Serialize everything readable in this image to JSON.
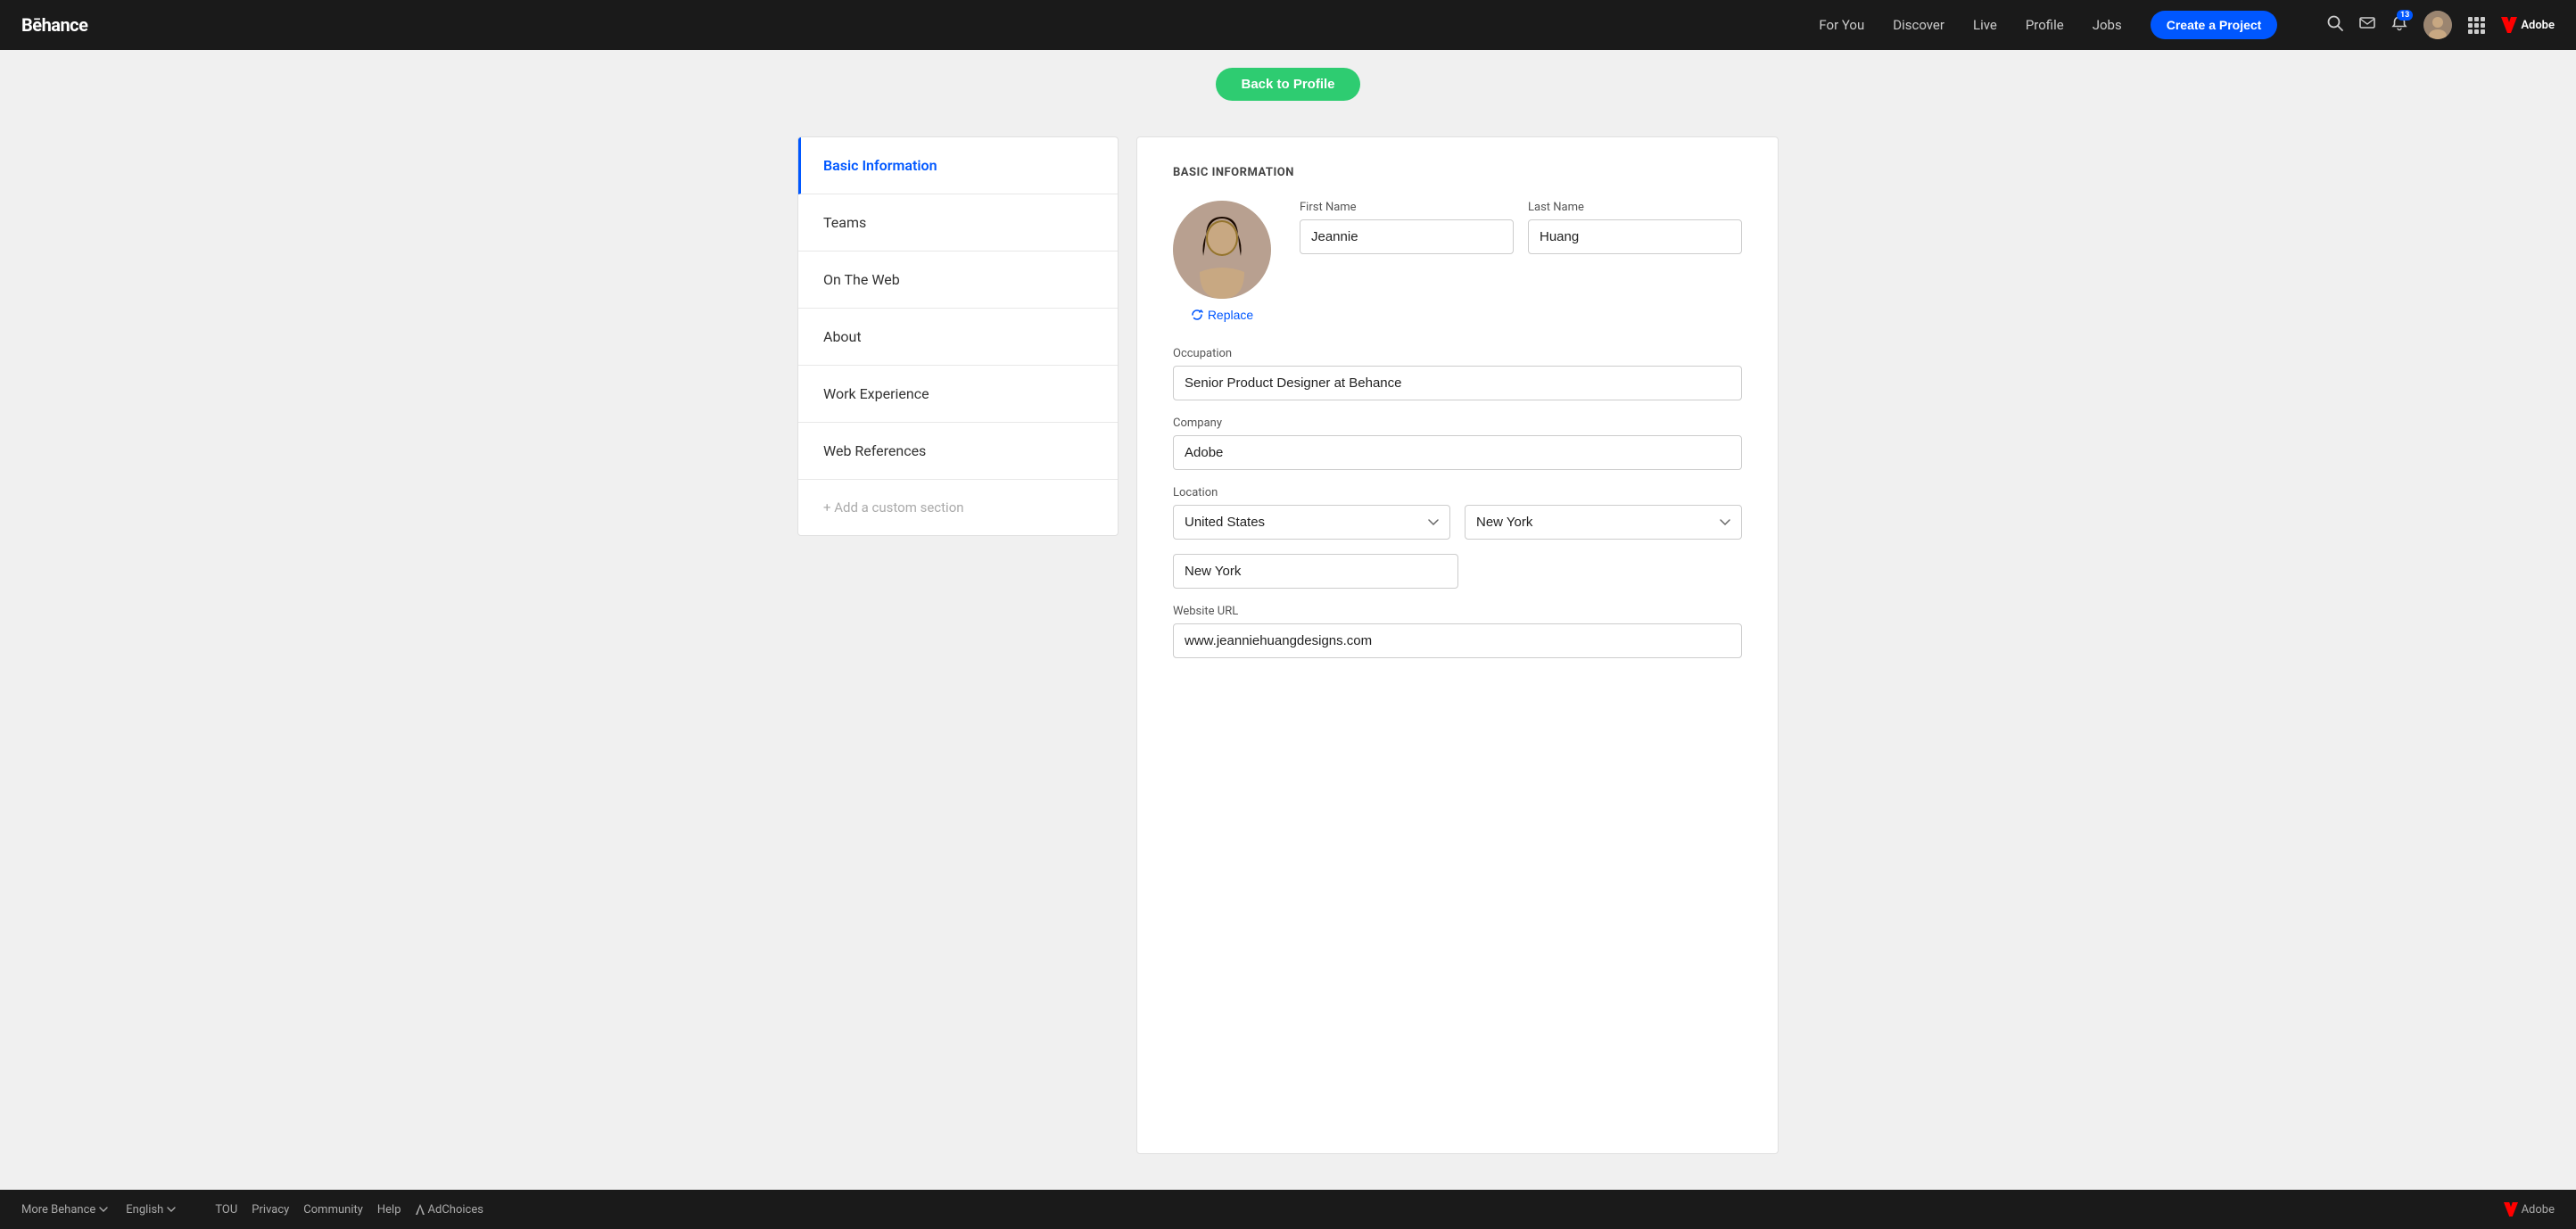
{
  "header": {
    "logo": "Bēhance",
    "nav": [
      {
        "label": "For You",
        "id": "for-you"
      },
      {
        "label": "Discover",
        "id": "discover"
      },
      {
        "label": "Live",
        "id": "live"
      },
      {
        "label": "Profile",
        "id": "profile"
      },
      {
        "label": "Jobs",
        "id": "jobs"
      }
    ],
    "create_project_label": "Create a Project",
    "notification_count": "13",
    "adobe_label": "Adobe"
  },
  "back_bar": {
    "button_label": "Back to Profile"
  },
  "sidebar": {
    "items": [
      {
        "label": "Basic Information",
        "id": "basic-information",
        "active": true
      },
      {
        "label": "Teams",
        "id": "teams",
        "active": false
      },
      {
        "label": "On The Web",
        "id": "on-the-web",
        "active": false
      },
      {
        "label": "About",
        "id": "about",
        "active": false
      },
      {
        "label": "Work Experience",
        "id": "work-experience",
        "active": false
      },
      {
        "label": "Web References",
        "id": "web-references",
        "active": false
      }
    ],
    "add_custom_label": "+ Add a custom section"
  },
  "form": {
    "section_title": "BASIC INFORMATION",
    "replace_label": "Replace",
    "fields": {
      "first_name_label": "First Name",
      "first_name_value": "Jeannie",
      "last_name_label": "Last Name",
      "last_name_value": "Huang",
      "occupation_label": "Occupation",
      "occupation_value": "Senior Product Designer at Behance",
      "company_label": "Company",
      "company_value": "Adobe",
      "location_label": "Location",
      "country_value": "United States",
      "state_value": "New York",
      "city_value": "New York",
      "website_label": "Website URL",
      "website_value": "www.jeanniehuangdesigns.com"
    }
  },
  "footer": {
    "more_behance_label": "More Behance",
    "language_label": "English",
    "tou_label": "TOU",
    "privacy_label": "Privacy",
    "community_label": "Community",
    "help_label": "Help",
    "adchoices_label": "AdChoices",
    "adobe_label": "Adobe"
  }
}
